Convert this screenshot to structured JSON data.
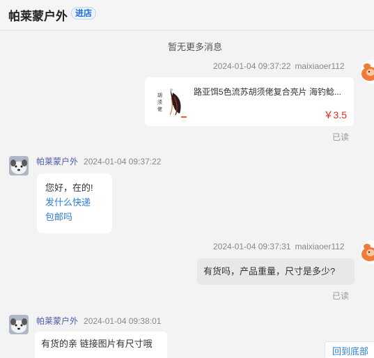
{
  "header": {
    "shop_name": "帕莱蒙户外",
    "enter_label": "进店"
  },
  "system": {
    "no_more": "暂无更多消息"
  },
  "messages": [
    {
      "time": "2024-01-04 09:37:22",
      "sender": "maixiaoer112",
      "product": {
        "title": "路亚饵5色流苏胡须佬复合亮片 海钓鲶...",
        "price": "￥3.5"
      },
      "status": "已读"
    },
    {
      "sender": "帕莱蒙户外",
      "time": "2024-01-04 09:37:22",
      "text": "您好，在的!",
      "links": [
        "发什么快递",
        "包邮吗"
      ]
    },
    {
      "time": "2024-01-04 09:37:31",
      "sender": "maixiaoer112",
      "text": "有货吗，产品重量，尺寸是多少?",
      "status": "已读"
    },
    {
      "sender": "帕莱蒙户外",
      "time": "2024-01-04 09:38:01",
      "text": "有货的亲 链接图片有尺寸哦"
    }
  ],
  "scroll_to_bottom_label": "回到底部",
  "colors": {
    "price": "#e0291c",
    "link": "#2c7ed6",
    "shop_sender": "#4a5aa8"
  },
  "icons": {
    "user_avatar": "cartoon-avatar",
    "shop_avatar": "dog-avatar",
    "product_thumb": "fishing-lure"
  }
}
